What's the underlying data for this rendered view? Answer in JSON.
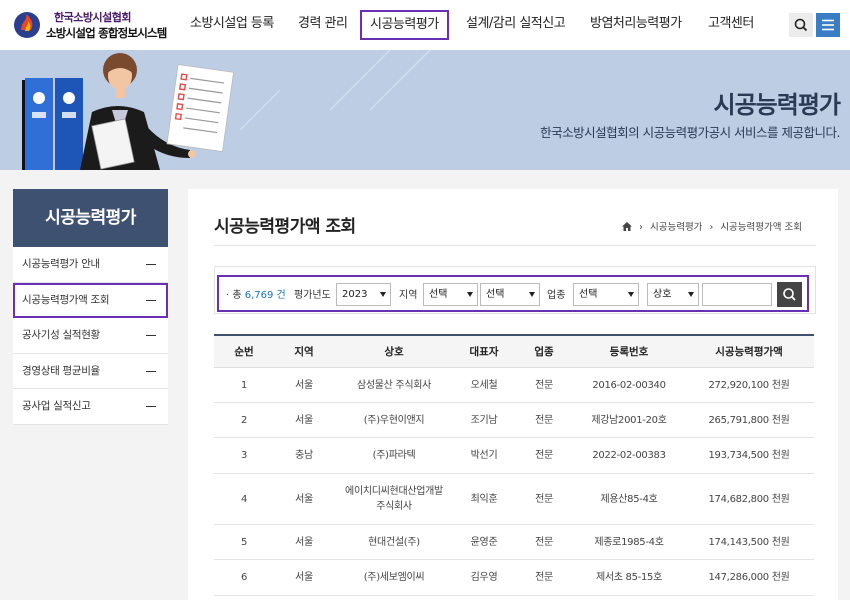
{
  "header": {
    "logo_line1": "한국소방시설협회",
    "logo_line2": "소방시설업 종합정보시스템",
    "nav": [
      {
        "label": "소방시설업 등록",
        "active": false
      },
      {
        "label": "경력 관리",
        "active": false
      },
      {
        "label": "시공능력평가",
        "active": true
      },
      {
        "label": "설계/감리 실적신고",
        "active": false
      },
      {
        "label": "방염처리능력평가",
        "active": false
      },
      {
        "label": "고객센터",
        "active": false
      }
    ],
    "search_icon": "search-icon",
    "menu_icon": "hamburger-menu-icon"
  },
  "banner": {
    "title": "시공능력평가",
    "subtitle": "한국소방시설협회의 시공능력평가공시 서비스를 제공합니다."
  },
  "sidebar": {
    "title": "시공능력평가",
    "items": [
      {
        "label": "시공능력평가 안내",
        "active": false
      },
      {
        "label": "시공능력평가액 조회",
        "active": true
      },
      {
        "label": "공사기성 실적현황",
        "active": false
      },
      {
        "label": "경영상태 평균비율",
        "active": false
      },
      {
        "label": "공사업 실적신고",
        "active": false
      }
    ]
  },
  "main": {
    "title": "시공능력평가액 조회",
    "breadcrumb": [
      "시공능력평가",
      "시공능력평가액 조회"
    ]
  },
  "filter": {
    "total_prefix": "· 총",
    "total_count": "6,769 건",
    "year_label": "평가년도",
    "year_value": "2023",
    "region_label": "지역",
    "region_value": "선택",
    "region2_value": "선택",
    "industry_label": "업종",
    "industry_value": "선택",
    "search_type_value": "상호",
    "search_input_value": ""
  },
  "table": {
    "columns": [
      "순번",
      "지역",
      "상호",
      "대표자",
      "업종",
      "등록번호",
      "시공능력평가액"
    ],
    "rows": [
      [
        "1",
        "서울",
        "삼성물산 주식회사",
        "오세철",
        "전문",
        "2016-02-00340",
        "272,920,100 천원"
      ],
      [
        "2",
        "서울",
        "(주)우현이앤지",
        "조기남",
        "전문",
        "제강남2001-20호",
        "265,791,800 천원"
      ],
      [
        "3",
        "충남",
        "(주)파라텍",
        "박선기",
        "전문",
        "2022-02-00383",
        "193,734,500 천원"
      ],
      [
        "4",
        "서울",
        "에이치디씨현대산업개발 주식회사",
        "최익훈",
        "전문",
        "제용산85-4호",
        "174,682,800 천원"
      ],
      [
        "5",
        "서울",
        "현대건설(주)",
        "윤영준",
        "전문",
        "제종로1985-4호",
        "174,143,500 천원"
      ],
      [
        "6",
        "서울",
        "(주)세보엠이씨",
        "김우영",
        "전문",
        "제서초 85-15호",
        "147,286,000 천원"
      ],
      [
        "",
        "",
        "",
        "",
        "",
        "",
        ""
      ]
    ]
  },
  "colors": {
    "accent_outline": "#6a2fb5",
    "navy": "#3e5170",
    "link_blue": "#1a6fc4",
    "banner_bg": "#bccde4",
    "menu_blue": "#3b7dc4"
  }
}
